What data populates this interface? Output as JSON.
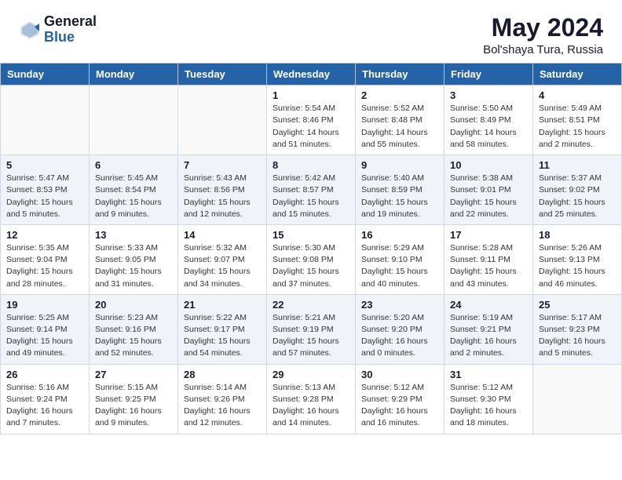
{
  "header": {
    "logo_general": "General",
    "logo_blue": "Blue",
    "month_year": "May 2024",
    "location": "Bol'shaya Tura, Russia"
  },
  "days_of_week": [
    "Sunday",
    "Monday",
    "Tuesday",
    "Wednesday",
    "Thursday",
    "Friday",
    "Saturday"
  ],
  "weeks": [
    [
      {
        "day": "",
        "info": ""
      },
      {
        "day": "",
        "info": ""
      },
      {
        "day": "",
        "info": ""
      },
      {
        "day": "1",
        "info": "Sunrise: 5:54 AM\nSunset: 8:46 PM\nDaylight: 14 hours\nand 51 minutes."
      },
      {
        "day": "2",
        "info": "Sunrise: 5:52 AM\nSunset: 8:48 PM\nDaylight: 14 hours\nand 55 minutes."
      },
      {
        "day": "3",
        "info": "Sunrise: 5:50 AM\nSunset: 8:49 PM\nDaylight: 14 hours\nand 58 minutes."
      },
      {
        "day": "4",
        "info": "Sunrise: 5:49 AM\nSunset: 8:51 PM\nDaylight: 15 hours\nand 2 minutes."
      }
    ],
    [
      {
        "day": "5",
        "info": "Sunrise: 5:47 AM\nSunset: 8:53 PM\nDaylight: 15 hours\nand 5 minutes."
      },
      {
        "day": "6",
        "info": "Sunrise: 5:45 AM\nSunset: 8:54 PM\nDaylight: 15 hours\nand 9 minutes."
      },
      {
        "day": "7",
        "info": "Sunrise: 5:43 AM\nSunset: 8:56 PM\nDaylight: 15 hours\nand 12 minutes."
      },
      {
        "day": "8",
        "info": "Sunrise: 5:42 AM\nSunset: 8:57 PM\nDaylight: 15 hours\nand 15 minutes."
      },
      {
        "day": "9",
        "info": "Sunrise: 5:40 AM\nSunset: 8:59 PM\nDaylight: 15 hours\nand 19 minutes."
      },
      {
        "day": "10",
        "info": "Sunrise: 5:38 AM\nSunset: 9:01 PM\nDaylight: 15 hours\nand 22 minutes."
      },
      {
        "day": "11",
        "info": "Sunrise: 5:37 AM\nSunset: 9:02 PM\nDaylight: 15 hours\nand 25 minutes."
      }
    ],
    [
      {
        "day": "12",
        "info": "Sunrise: 5:35 AM\nSunset: 9:04 PM\nDaylight: 15 hours\nand 28 minutes."
      },
      {
        "day": "13",
        "info": "Sunrise: 5:33 AM\nSunset: 9:05 PM\nDaylight: 15 hours\nand 31 minutes."
      },
      {
        "day": "14",
        "info": "Sunrise: 5:32 AM\nSunset: 9:07 PM\nDaylight: 15 hours\nand 34 minutes."
      },
      {
        "day": "15",
        "info": "Sunrise: 5:30 AM\nSunset: 9:08 PM\nDaylight: 15 hours\nand 37 minutes."
      },
      {
        "day": "16",
        "info": "Sunrise: 5:29 AM\nSunset: 9:10 PM\nDaylight: 15 hours\nand 40 minutes."
      },
      {
        "day": "17",
        "info": "Sunrise: 5:28 AM\nSunset: 9:11 PM\nDaylight: 15 hours\nand 43 minutes."
      },
      {
        "day": "18",
        "info": "Sunrise: 5:26 AM\nSunset: 9:13 PM\nDaylight: 15 hours\nand 46 minutes."
      }
    ],
    [
      {
        "day": "19",
        "info": "Sunrise: 5:25 AM\nSunset: 9:14 PM\nDaylight: 15 hours\nand 49 minutes."
      },
      {
        "day": "20",
        "info": "Sunrise: 5:23 AM\nSunset: 9:16 PM\nDaylight: 15 hours\nand 52 minutes."
      },
      {
        "day": "21",
        "info": "Sunrise: 5:22 AM\nSunset: 9:17 PM\nDaylight: 15 hours\nand 54 minutes."
      },
      {
        "day": "22",
        "info": "Sunrise: 5:21 AM\nSunset: 9:19 PM\nDaylight: 15 hours\nand 57 minutes."
      },
      {
        "day": "23",
        "info": "Sunrise: 5:20 AM\nSunset: 9:20 PM\nDaylight: 16 hours\nand 0 minutes."
      },
      {
        "day": "24",
        "info": "Sunrise: 5:19 AM\nSunset: 9:21 PM\nDaylight: 16 hours\nand 2 minutes."
      },
      {
        "day": "25",
        "info": "Sunrise: 5:17 AM\nSunset: 9:23 PM\nDaylight: 16 hours\nand 5 minutes."
      }
    ],
    [
      {
        "day": "26",
        "info": "Sunrise: 5:16 AM\nSunset: 9:24 PM\nDaylight: 16 hours\nand 7 minutes."
      },
      {
        "day": "27",
        "info": "Sunrise: 5:15 AM\nSunset: 9:25 PM\nDaylight: 16 hours\nand 9 minutes."
      },
      {
        "day": "28",
        "info": "Sunrise: 5:14 AM\nSunset: 9:26 PM\nDaylight: 16 hours\nand 12 minutes."
      },
      {
        "day": "29",
        "info": "Sunrise: 5:13 AM\nSunset: 9:28 PM\nDaylight: 16 hours\nand 14 minutes."
      },
      {
        "day": "30",
        "info": "Sunrise: 5:12 AM\nSunset: 9:29 PM\nDaylight: 16 hours\nand 16 minutes."
      },
      {
        "day": "31",
        "info": "Sunrise: 5:12 AM\nSunset: 9:30 PM\nDaylight: 16 hours\nand 18 minutes."
      },
      {
        "day": "",
        "info": ""
      }
    ]
  ]
}
